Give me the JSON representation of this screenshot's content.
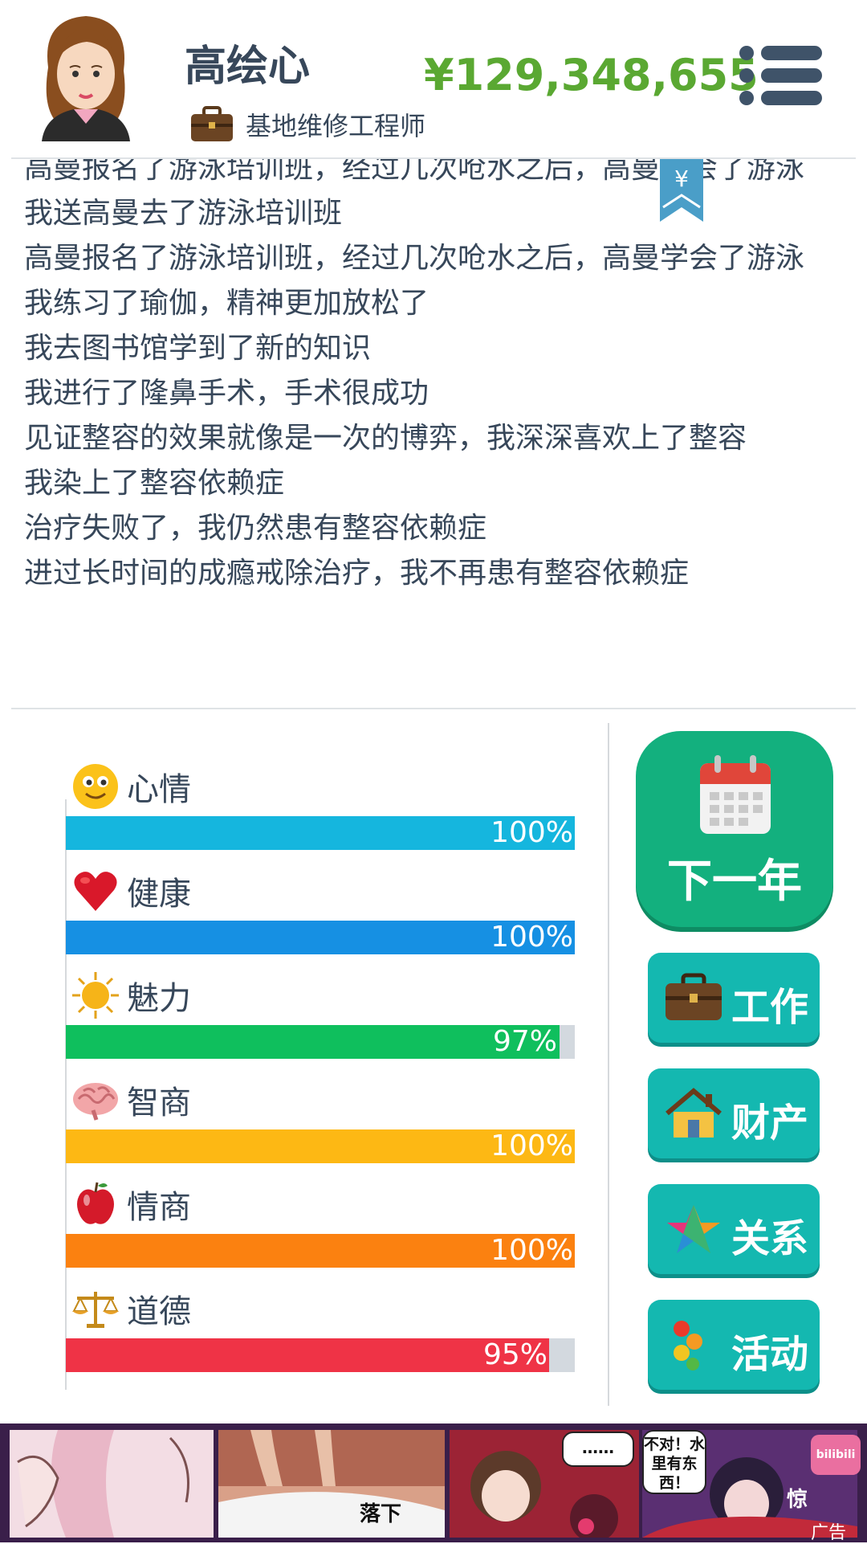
{
  "header": {
    "name": "高绘心",
    "job": "基地维修工程师",
    "money": "¥129,348,655",
    "bookmark_symbol": "¥"
  },
  "log": {
    "lines": [
      "高曼报名了游泳培训班，经过几次呛水之后，高曼学会了游泳",
      "我送高曼去了游泳培训班",
      "高曼报名了游泳培训班，经过几次呛水之后，高曼学会了游泳",
      "我练习了瑜伽，精神更加放松了",
      "我去图书馆学到了新的知识",
      "我进行了隆鼻手术，手术很成功",
      "见证整容的效果就像是一次的博弈，我深深喜欢上了整容",
      "我染上了整容依赖症",
      "治疗失败了，我仍然患有整容依赖症",
      "进过长时间的成瘾戒除治疗，我不再患有整容依赖症"
    ]
  },
  "stats": [
    {
      "label": "心情",
      "value": "100%",
      "fraction": 1.0,
      "color": "#15b6de",
      "icon": "smiley-face-icon"
    },
    {
      "label": "健康",
      "value": "100%",
      "fraction": 1.0,
      "color": "#1690e3",
      "icon": "heart-icon"
    },
    {
      "label": "魅力",
      "value": "97%",
      "fraction": 0.97,
      "color": "#0fbf5d",
      "icon": "sun-icon"
    },
    {
      "label": "智商",
      "value": "100%",
      "fraction": 1.0,
      "color": "#fdb814",
      "icon": "brain-icon"
    },
    {
      "label": "情商",
      "value": "100%",
      "fraction": 1.0,
      "color": "#fb8110",
      "icon": "apple-icon"
    },
    {
      "label": "道德",
      "value": "95%",
      "fraction": 0.95,
      "color": "#ef3346",
      "icon": "scales-icon"
    }
  ],
  "actions": {
    "next_year": "下一年",
    "work": "工作",
    "assets": "财产",
    "relations": "关系",
    "activity": "活动"
  },
  "ad": {
    "bubble_dots": "……",
    "bubble_text": "不对！水里有东西！",
    "sfx_1": "落下",
    "sfx_2": "惊",
    "badge": "bilibili",
    "label": "广告"
  },
  "colors": {
    "money": "#5aa832",
    "next_year_bg": "#13b07e",
    "side_btn_bg": "#14b8b0"
  }
}
